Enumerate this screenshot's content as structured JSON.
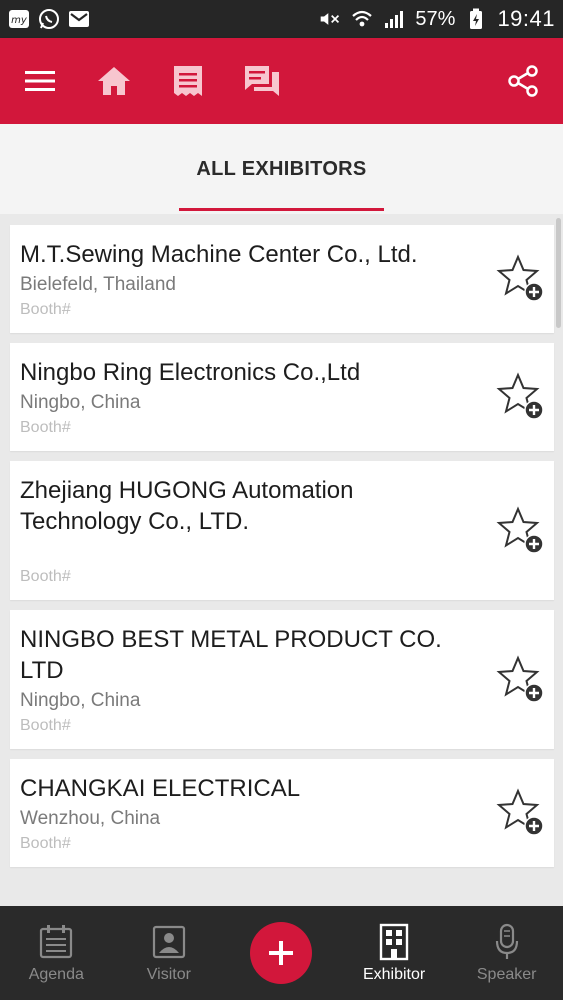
{
  "status_bar": {
    "battery": "57%",
    "time": "19:41"
  },
  "header": {
    "tab_title": "ALL EXHIBITORS"
  },
  "exhibitors": [
    {
      "name": "M.T.Sewing Machine Center Co., Ltd.",
      "location": "Bielefeld, Thailand",
      "booth": "Booth#"
    },
    {
      "name": "Ningbo Ring Electronics Co.,Ltd",
      "location": "Ningbo, China",
      "booth": "Booth#"
    },
    {
      "name": "Zhejiang HUGONG Automation Technology Co., LTD.",
      "location": "",
      "booth": "Booth#"
    },
    {
      "name": "NINGBO BEST METAL PRODUCT CO. LTD",
      "location": "Ningbo, China",
      "booth": "Booth#"
    },
    {
      "name": "CHANGKAI ELECTRICAL",
      "location": "Wenzhou, China",
      "booth": "Booth#"
    }
  ],
  "bottom_nav": {
    "agenda": "Agenda",
    "visitor": "Visitor",
    "exhibitor": "Exhibitor",
    "speaker": "Speaker"
  },
  "colors": {
    "brand": "#d2173b",
    "nav_bg": "#2a2a2a",
    "status_bg": "#262626"
  }
}
